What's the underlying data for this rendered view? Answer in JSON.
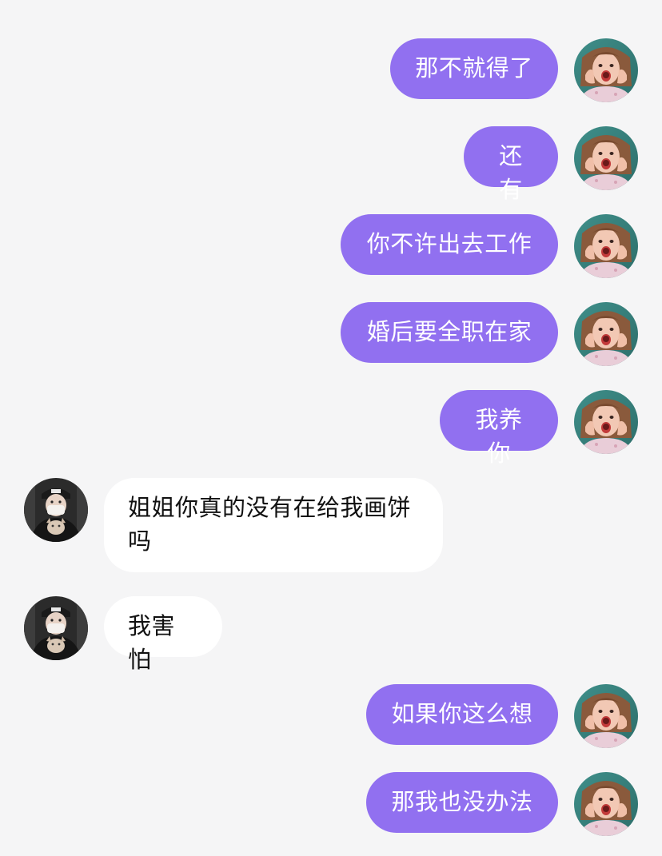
{
  "colors": {
    "background": "#f5f5f6",
    "outgoing_bubble": "#9170f0",
    "incoming_bubble": "#ffffff"
  },
  "messages": [
    {
      "sender": "self",
      "avatar": "self-avatar",
      "text": "那不就得了"
    },
    {
      "sender": "self",
      "avatar": "self-avatar",
      "text": "还有"
    },
    {
      "sender": "self",
      "avatar": "self-avatar",
      "text": "你不许出去工作"
    },
    {
      "sender": "self",
      "avatar": "self-avatar",
      "text": "婚后要全职在家"
    },
    {
      "sender": "self",
      "avatar": "self-avatar",
      "text": "我养你"
    },
    {
      "sender": "other",
      "avatar": "other-avatar",
      "text": "姐姐你真的没有在给我画饼吗"
    },
    {
      "sender": "other",
      "avatar": "other-avatar",
      "text": "我害怕"
    },
    {
      "sender": "self",
      "avatar": "self-avatar",
      "text": "如果你这么想"
    },
    {
      "sender": "self",
      "avatar": "self-avatar",
      "text": "那我也没办法"
    }
  ]
}
